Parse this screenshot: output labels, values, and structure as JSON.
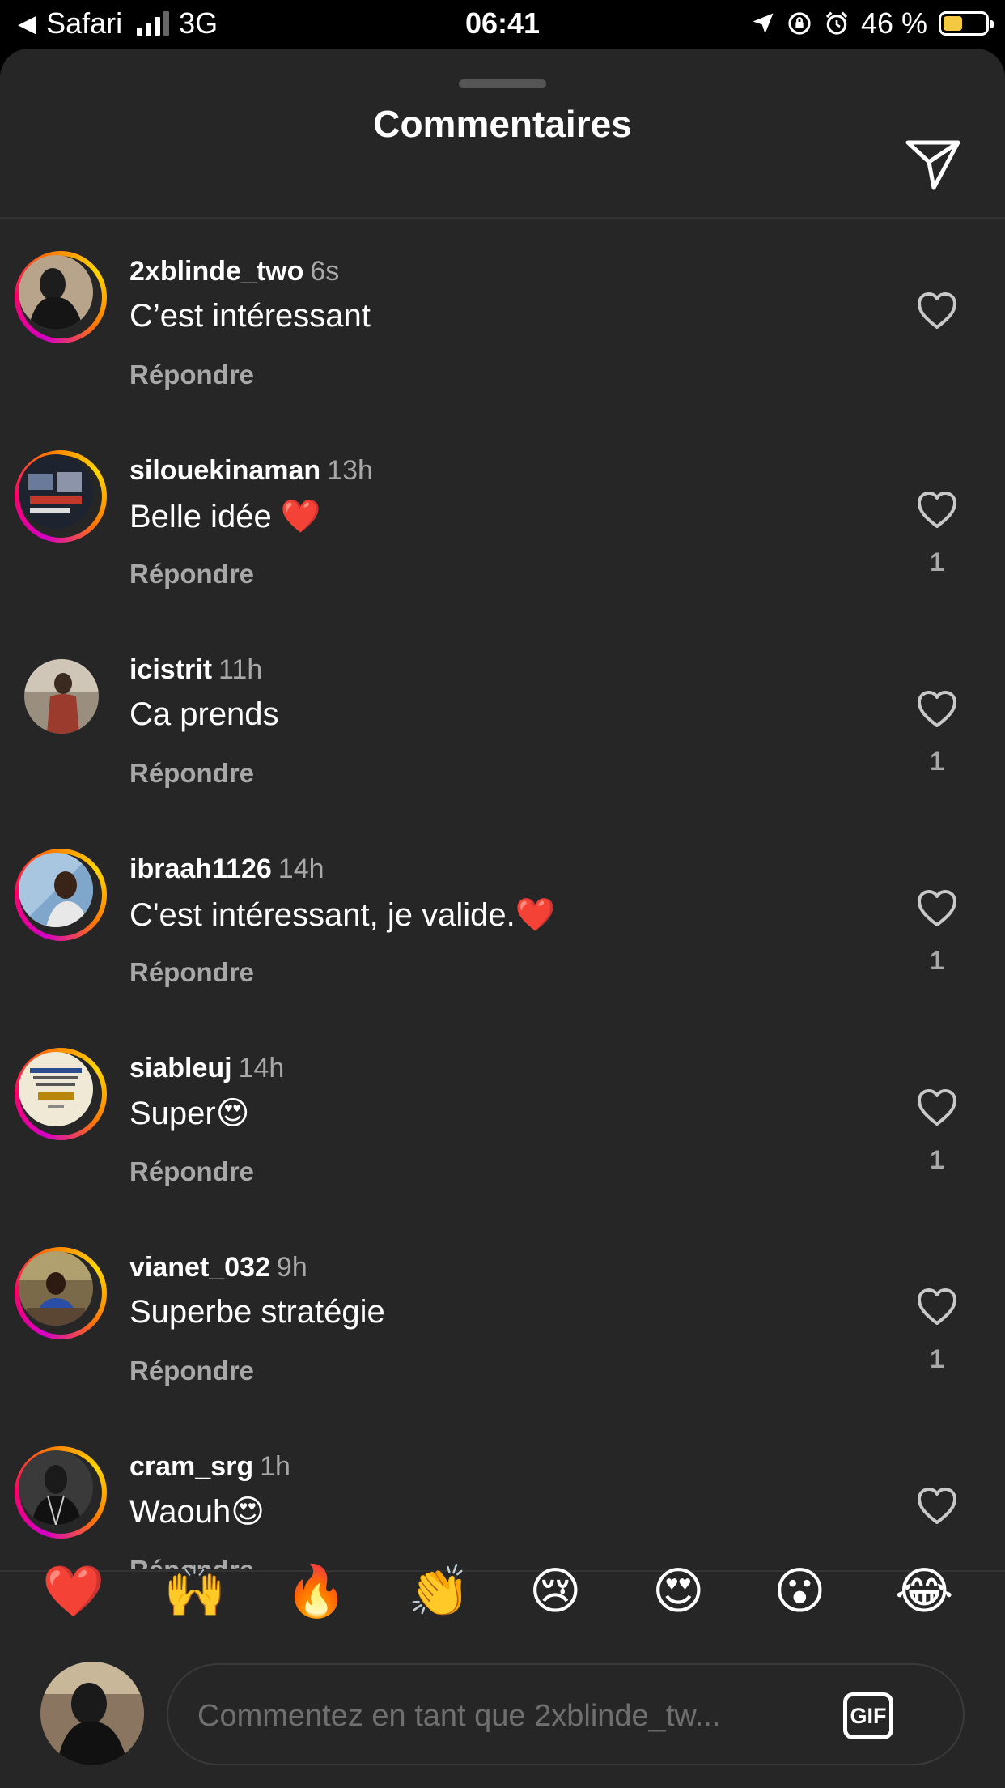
{
  "status_bar": {
    "back_app": "Safari",
    "network": "3G",
    "time": "06:41",
    "battery_text": "46 %",
    "battery_level": 0.46,
    "battery_color": "#f5c842"
  },
  "header": {
    "title": "Commentaires",
    "send_icon": "paper-plane-icon"
  },
  "comments": [
    {
      "username": "2xblinde_two",
      "time": "6s",
      "text": "C’est intéressant",
      "reply": "Répondre",
      "likes": ""
    },
    {
      "username": "silouekinaman",
      "time": "13h",
      "text": "Belle idée ❤️",
      "reply": "Répondre",
      "likes": "1"
    },
    {
      "username": "icistrit",
      "time": "11h",
      "text": "Ca prends",
      "reply": "Répondre",
      "likes": "1"
    },
    {
      "username": "ibraah1126",
      "time": "14h",
      "text": "C'est intéressant, je valide.❤️",
      "reply": "Répondre",
      "likes": "1"
    },
    {
      "username": "siableuj",
      "time": "14h",
      "text": "Super😍",
      "reply": "Répondre",
      "likes": "1"
    },
    {
      "username": "vianet_032",
      "time": "9h",
      "text": "Superbe stratégie",
      "reply": "Répondre",
      "likes": "1"
    },
    {
      "username": "cram_srg",
      "time": "1h",
      "text": "Waouh😍",
      "reply": "Répondre",
      "likes": ""
    }
  ],
  "reactions": [
    "❤️",
    "🙌",
    "🔥",
    "👏",
    "😢",
    "😍",
    "😮",
    "😂"
  ],
  "composer": {
    "placeholder": "Commentez en tant que 2xblinde_tw...",
    "gif_label": "GIF"
  },
  "colors": {
    "sheet_bg": "#262626",
    "muted_text": "#a8a8a8",
    "story_ring": [
      "#d300c5",
      "#ff0069",
      "#ff7a00",
      "#ffd600"
    ]
  }
}
